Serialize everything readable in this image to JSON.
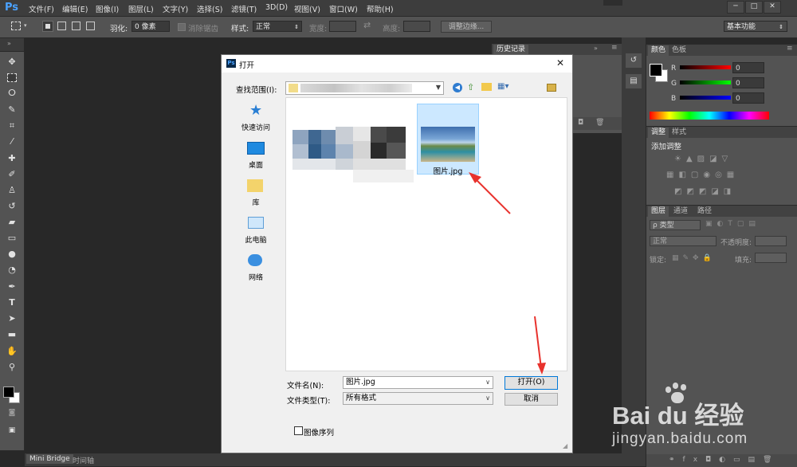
{
  "app": {
    "logo": "Ps",
    "menu": [
      "文件(F)",
      "编辑(E)",
      "图像(I)",
      "图层(L)",
      "文字(Y)",
      "选择(S)",
      "滤镜(T)",
      "3D(D)",
      "视图(V)",
      "窗口(W)",
      "帮助(H)"
    ],
    "window_controls": [
      "─",
      "□",
      "✕"
    ]
  },
  "options_bar": {
    "feather_label": "羽化:",
    "feather_value": "0 像素",
    "antialias_label": "消除锯齿",
    "style_label": "样式:",
    "style_value": "正常",
    "width_label": "宽度:",
    "height_label": "高度:",
    "refine_edge_button": "调整边缘...",
    "workspace_value": "基本功能"
  },
  "panels": {
    "history_tab": "历史记录",
    "color_tabs": [
      "颜色",
      "色板"
    ],
    "rgb": [
      {
        "channel": "R",
        "value": "0"
      },
      {
        "channel": "G",
        "value": "0"
      },
      {
        "channel": "B",
        "value": "0"
      }
    ],
    "adjust_tabs": [
      "调整",
      "样式"
    ],
    "adjust_title": "添加调整",
    "layers_tabs": [
      "图层",
      "通道",
      "路径"
    ],
    "layer_filter": "ρ 类型",
    "blend_mode": "正常",
    "opacity_label": "不透明度:",
    "lock_label": "锁定:",
    "fill_label": "填充:"
  },
  "bottom_tabs": [
    "Mini Bridge",
    "时间轴"
  ],
  "dialog": {
    "title": "打开",
    "title_icon": "Ps",
    "lookin_label": "查找范围(I):",
    "places": [
      "快速访问",
      "桌面",
      "库",
      "此电脑",
      "网络"
    ],
    "selected_file": "图片.jpg",
    "filename_label": "文件名(N):",
    "filename_value": "图片.jpg",
    "filetype_label": "文件类型(T):",
    "filetype_value": "所有格式",
    "open_button": "打开(O)",
    "cancel_button": "取消",
    "image_sequence_label": "图像序列"
  },
  "watermark": {
    "brand": "Bai du 经验",
    "url": "jingyan.baidu.com"
  },
  "colors": {
    "accent_arrow": "#e8322d",
    "ps_blue": "#4aa2ff",
    "selection": "#cce8ff"
  }
}
